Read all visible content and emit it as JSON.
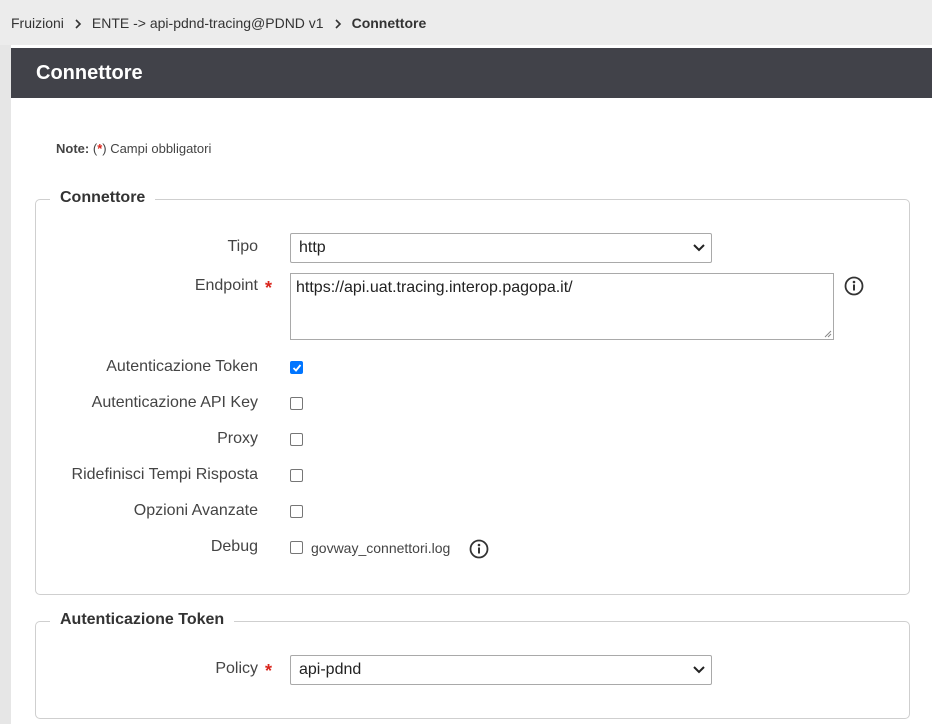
{
  "breadcrumb": {
    "items": [
      "Fruizioni",
      "ENTE -> api-pdnd-tracing@PDND v1",
      "Connettore"
    ]
  },
  "header": {
    "title": "Connettore"
  },
  "note": {
    "prefix": "Note:",
    "open": "(",
    "star": "*",
    "text": ") Campi obbligatori"
  },
  "connettore": {
    "legend": "Connettore",
    "tipo": {
      "label": "Tipo",
      "value": "http"
    },
    "endpoint": {
      "label": "Endpoint",
      "required_mark": "*",
      "value": "https://api.uat.tracing.interop.pagopa.it/"
    },
    "autenticazione_token": {
      "label": "Autenticazione Token",
      "checked": true
    },
    "autenticazione_api_key": {
      "label": "Autenticazione API Key",
      "checked": false
    },
    "proxy": {
      "label": "Proxy",
      "checked": false
    },
    "ridefinisci_tempi": {
      "label": "Ridefinisci Tempi Risposta",
      "checked": false
    },
    "opzioni_avanzate": {
      "label": "Opzioni Avanzate",
      "checked": false
    },
    "debug": {
      "label": "Debug",
      "checked": false,
      "file": "govway_connettori.log"
    }
  },
  "autenticazione_token_section": {
    "legend": "Autenticazione Token",
    "policy": {
      "label": "Policy",
      "required_mark": "*",
      "value": "api-pdnd"
    }
  },
  "colors": {
    "header_bg": "#414249",
    "breadcrumb_bg": "#ececec",
    "required": "#d9251c",
    "checkbox_checked": "#0075ff"
  }
}
